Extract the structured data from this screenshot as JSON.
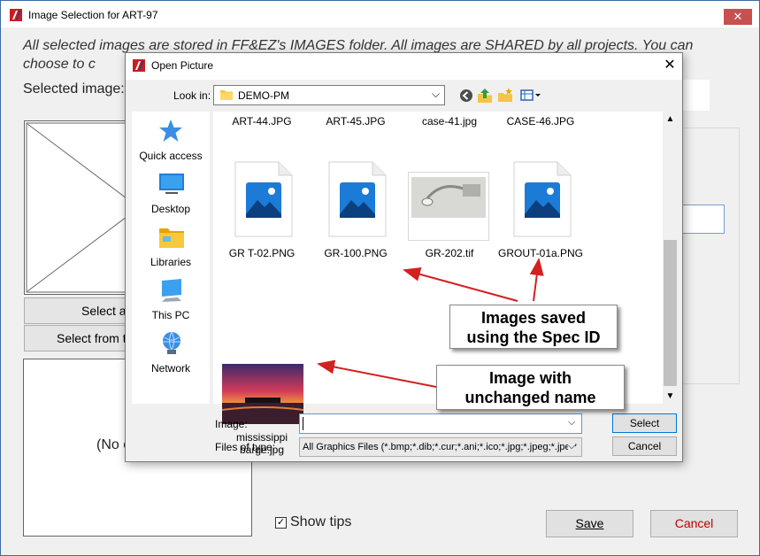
{
  "outer_window": {
    "title": "Image Selection for ART-97",
    "close_glyph": "✕",
    "instructions": "All selected images are stored in FF&EZ's IMAGES folder. All images are SHARED by all projects. You can choose to c",
    "selected_image_label": "Selected image:",
    "select_a_button": "Select a",
    "select_from_button": "Select from th",
    "no_image_text": "(No c",
    "show_tips_label": "Show tips",
    "show_tips_checked": "✓",
    "save_button": "Save",
    "cancel_button": "Cancel",
    "accent_colors": {
      "cancel_text": "#c00000",
      "close_button": "#c75050"
    }
  },
  "dialog": {
    "title": "Open Picture",
    "close_glyph": "✕",
    "look_in_label": "Look in:",
    "look_in_value": "DEMO-PM",
    "toolbar_icons": [
      "back-icon",
      "up-folder-icon",
      "new-folder-icon",
      "view-menu-icon"
    ],
    "places": [
      {
        "label": "Quick access",
        "icon": "star-icon"
      },
      {
        "label": "Desktop",
        "icon": "desktop-icon"
      },
      {
        "label": "Libraries",
        "icon": "libraries-icon"
      },
      {
        "label": "This PC",
        "icon": "computer-icon"
      },
      {
        "label": "Network",
        "icon": "network-icon"
      }
    ],
    "files": [
      {
        "name": "ART-44.JPG"
      },
      {
        "name": "ART-45.JPG"
      },
      {
        "name": "case-41.jpg"
      },
      {
        "name": "CASE-46.JPG"
      },
      {
        "name": "GR T-02.PNG",
        "thumb": "image-file-icon"
      },
      {
        "name": "GR-100.PNG",
        "thumb": "image-file-icon"
      },
      {
        "name": "GR-202.tif",
        "thumb": "photo-thumbnail"
      },
      {
        "name": "GROUT-01a.PNG",
        "thumb": "image-file-icon"
      },
      {
        "name_line1": "mississippi",
        "name_line2": "barge.jpg",
        "thumb": "sunset-photo-thumbnail"
      }
    ],
    "image_label": "Image:",
    "image_value": "",
    "files_of_type_label": "Files of type:",
    "files_of_type_value": "All Graphics Files (*.bmp;*.dib;*.cur;*.ani;*.ico;*.jpg;*.jpeg;*.jpe;*",
    "select_button": "Select",
    "cancel_button": "Cancel"
  },
  "callouts": {
    "spec_line1": "Images saved",
    "spec_line2": "using the Spec ID",
    "unchanged_line1": "Image with",
    "unchanged_line2": "unchanged name",
    "arrow_color": "#d42020"
  }
}
